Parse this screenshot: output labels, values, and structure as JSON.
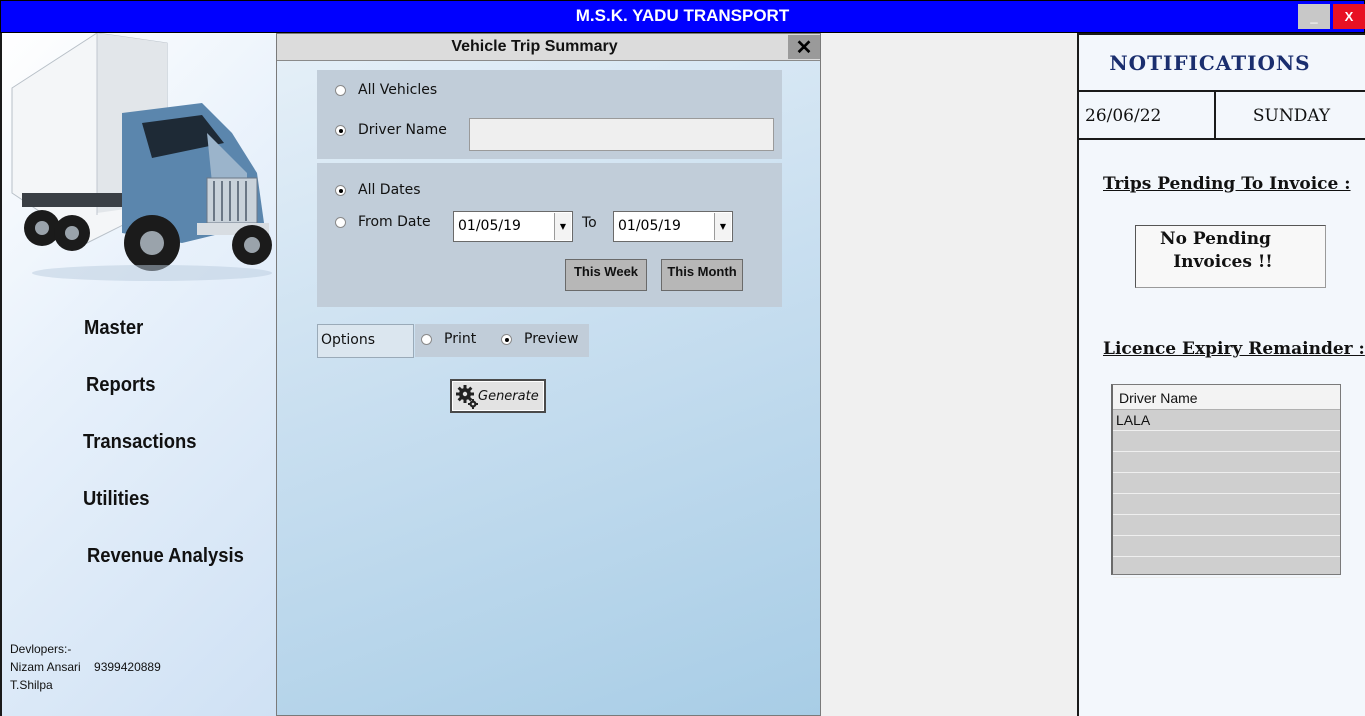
{
  "app": {
    "title": "M.S.K. YADU TRANSPORT",
    "minimize": "_",
    "close": "X"
  },
  "sidebar": {
    "items": [
      "Master",
      "Reports",
      "Transactions",
      "Utilities",
      "Revenue Analysis"
    ],
    "developers_heading": "Devlopers:-",
    "developer1": "Nizam Ansari    9399420889",
    "developer2": "T.Shilpa"
  },
  "dialog": {
    "title": "Vehicle Trip Summary",
    "close_icon": "✕",
    "vehicle_filter": {
      "all_vehicles": "All Vehicles",
      "driver_name": "Driver Name",
      "selected": "driver_name",
      "driver_value": ""
    },
    "date_filter": {
      "all_dates": "All Dates",
      "from_date": "From Date",
      "selected": "all_dates",
      "from_value": "01/05/19",
      "to_label": "To",
      "to_value": "01/05/19",
      "this_week": "This Week",
      "this_month": "This Month"
    },
    "options": {
      "label": "Options",
      "print": "Print",
      "preview": "Preview",
      "selected": "preview"
    },
    "generate": "Generate"
  },
  "notifications": {
    "title": "NOTIFICATIONS",
    "date": "26/06/22",
    "day": "SUNDAY",
    "trips_title": "Trips Pending To Invoice :",
    "pending_line1": "No   Pending",
    "pending_line2": "Invoices  !!",
    "licence_title": "Licence Expiry Remainder :",
    "table_header": "Driver Name",
    "rows": [
      "LALA",
      "",
      "",
      "",
      "",
      "",
      "",
      ""
    ]
  },
  "icons": {
    "generate": "gear-icon",
    "truck": "truck-image",
    "dropdown": "chevron-down-icon"
  }
}
